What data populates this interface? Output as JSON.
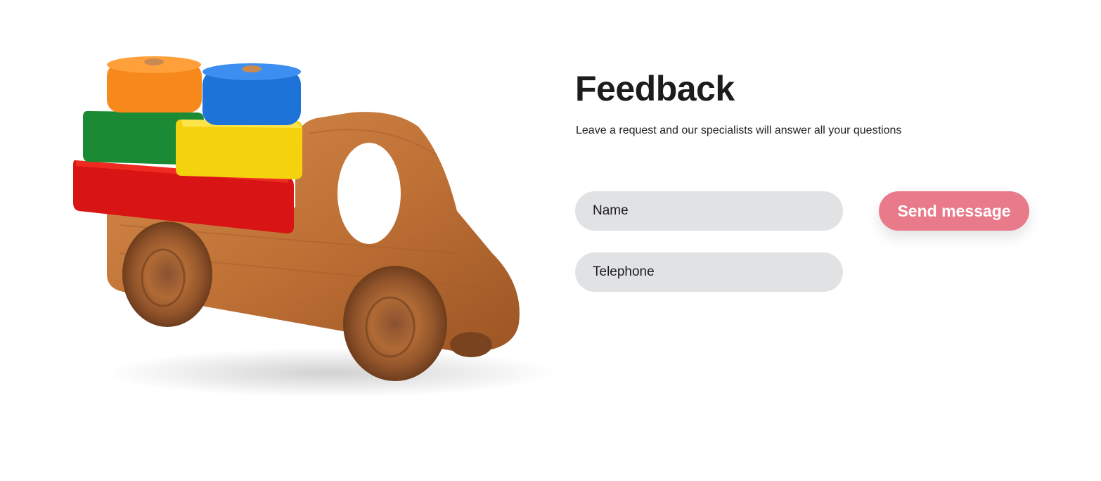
{
  "feedback": {
    "title": "Feedback",
    "subtitle": "Leave a request and our specialists will answer all your questions",
    "name_placeholder": "Name",
    "telephone_placeholder": "Telephone",
    "send_label": "Send message"
  },
  "colors": {
    "button": "#e97a89",
    "field_bg": "#e1e2e4",
    "text": "#1c1c1c"
  },
  "image": {
    "subject": "wooden-toy-truck-with-colored-blocks"
  }
}
